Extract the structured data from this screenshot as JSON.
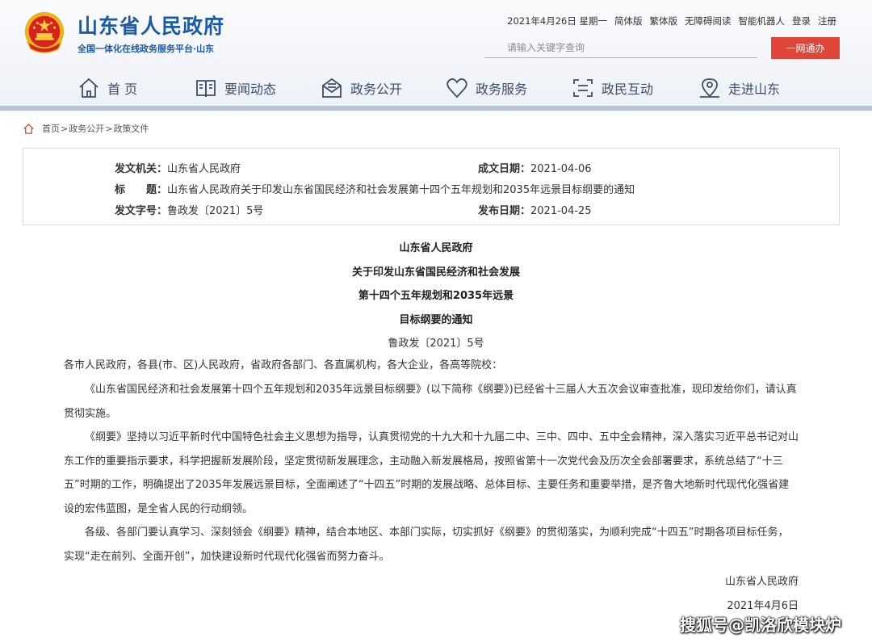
{
  "header": {
    "title": "山东省人民政府",
    "subtitle": "全国一体化在线政务服务平台·山东",
    "date": "2021年4月26日 星期一",
    "links": [
      "简体版",
      "繁体版",
      "无障碍阅读",
      "智能机器人",
      "登录",
      "注册"
    ],
    "search_placeholder": "请输入关键字查询",
    "login_button": "一网通办"
  },
  "nav": {
    "items": [
      {
        "label": "首 页",
        "icon": "home-icon"
      },
      {
        "label": "要闻动态",
        "icon": "book-icon"
      },
      {
        "label": "政务公开",
        "icon": "mail-icon"
      },
      {
        "label": "政务服务",
        "icon": "heart-icon"
      },
      {
        "label": "政民互动",
        "icon": "interaction-icon"
      },
      {
        "label": "走进山东",
        "icon": "location-icon"
      }
    ]
  },
  "breadcrumb": {
    "items": [
      "首页",
      "政务公开",
      "政策文件"
    ],
    "separator": ">"
  },
  "meta": {
    "issuer_key": "发文机关：",
    "issuer": "山东省人民政府",
    "created_key": "成文日期：",
    "created": "2021-04-06",
    "title_key": "标　　题：",
    "title": "山东省人民政府关于印发山东省国民经济和社会发展第十四个五年规划和2035年远景目标纲要的通知",
    "docno_key": "发文字号：",
    "docno": "鲁政发〔2021〕5号",
    "published_key": "发布日期：",
    "published": "2021-04-25"
  },
  "document": {
    "title_lines": [
      "山东省人民政府",
      "关于印发山东省国民经济和社会发展",
      "第十四个五年规划和2035年远景",
      "目标纲要的通知"
    ],
    "number": "鲁政发〔2021〕5号",
    "salutation": "各市人民政府，各县(市、区)人民政府，省政府各部门、各直属机构，各大企业，各高等院校：",
    "paragraphs": [
      "《山东省国民经济和社会发展第十四个五年规划和2035年远景目标纲要》(以下简称《纲要》)已经省十三届人大五次会议审查批准，现印发给你们，请认真贯彻实施。",
      "《纲要》坚持以习近平新时代中国特色社会主义思想为指导，认真贯彻党的十九大和十九届二中、三中、四中、五中全会精神，深入落实习近平总书记对山东工作的重要指示要求，科学把握新发展阶段，坚定贯彻新发展理念，主动融入新发展格局，按照省第十一次党代会及历次全会部署要求，系统总结了“十三五”时期的工作，明确提出了2035年发展远景目标，全面阐述了“十四五”时期的发展战略、总体目标、主要任务和重要举措，是齐鲁大地新时代现代化强省建设的宏伟蓝图，是全省人民的行动纲领。",
      "各级、各部门要认真学习、深刻领会《纲要》精神，结合本地区、本部门实际，切实抓好《纲要》的贯彻落实，为顺利完成“十四五”时期各项目标任务，实现“走在前列、全面开创”，加快建设新时代现代化强省而努力奋斗。"
    ],
    "signature": "山东省人民政府",
    "sign_date": "2021年4月6日"
  },
  "watermark": "搜狐号@凯洛欣模块炉",
  "colors": {
    "brand_blue": "#1b5aa6",
    "nav_text": "#3d4e6b",
    "button_red": "#df4538",
    "header_bar": "#b8c3d6"
  }
}
